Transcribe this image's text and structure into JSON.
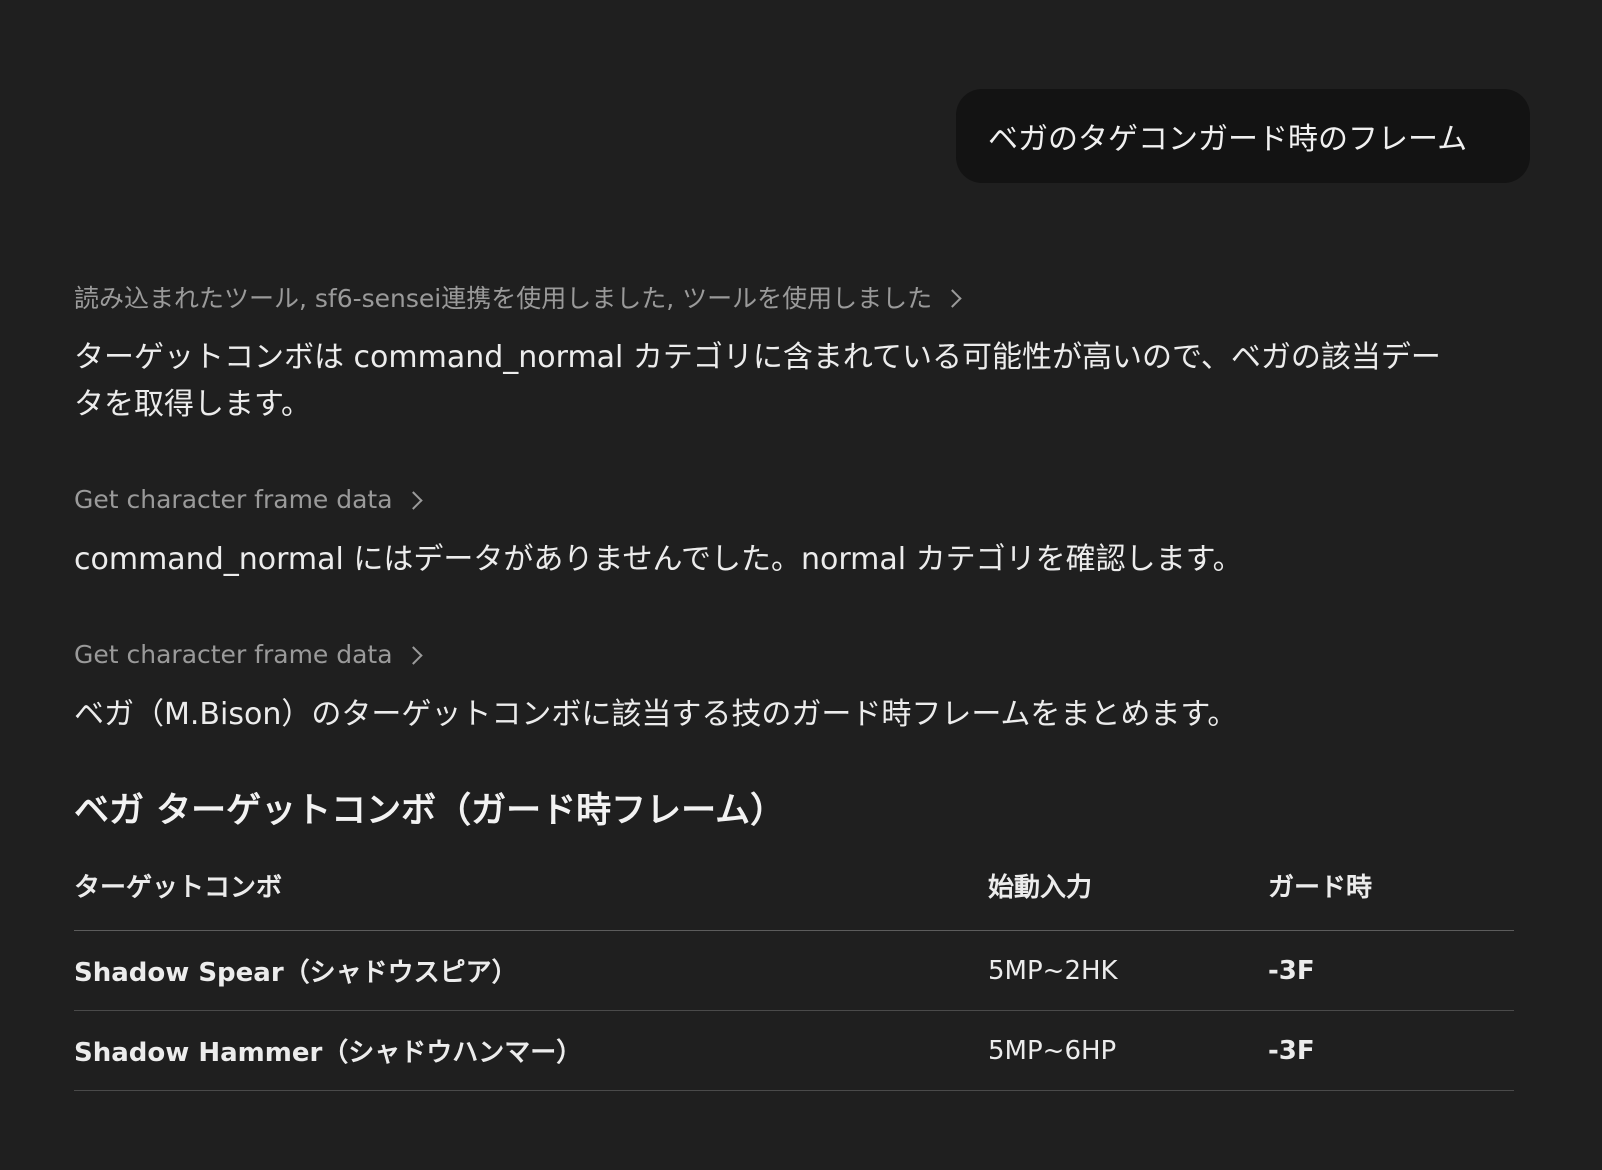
{
  "user_message": "ベガのタゲコンガード時のフレーム",
  "assistant": {
    "tool_summary_1": "読み込まれたツール, sf6-sensei連携を使用しました, ツールを使用しました",
    "paragraph_1": "ターゲットコンボは command_normal カテゴリに含まれている可能性が高いので、ベガの該当データを取得します。",
    "tool_summary_2": "Get character frame data",
    "paragraph_2": "command_normal にはデータがありませんでした。normal カテゴリを確認します。",
    "tool_summary_3": "Get character frame data",
    "paragraph_3": "ベガ（M.Bison）のターゲットコンボに該当する技のガード時フレームをまとめます。",
    "section_title": "ベガ ターゲットコンボ（ガード時フレーム）",
    "table": {
      "headers": [
        "ターゲットコンボ",
        "始動入力",
        "ガード時"
      ],
      "rows": [
        [
          "Shadow Spear（シャドウスピア）",
          "5MP~2HK",
          "-3F"
        ],
        [
          "Shadow Hammer（シャドウハンマー）",
          "5MP~6HP",
          "-3F"
        ]
      ]
    }
  }
}
